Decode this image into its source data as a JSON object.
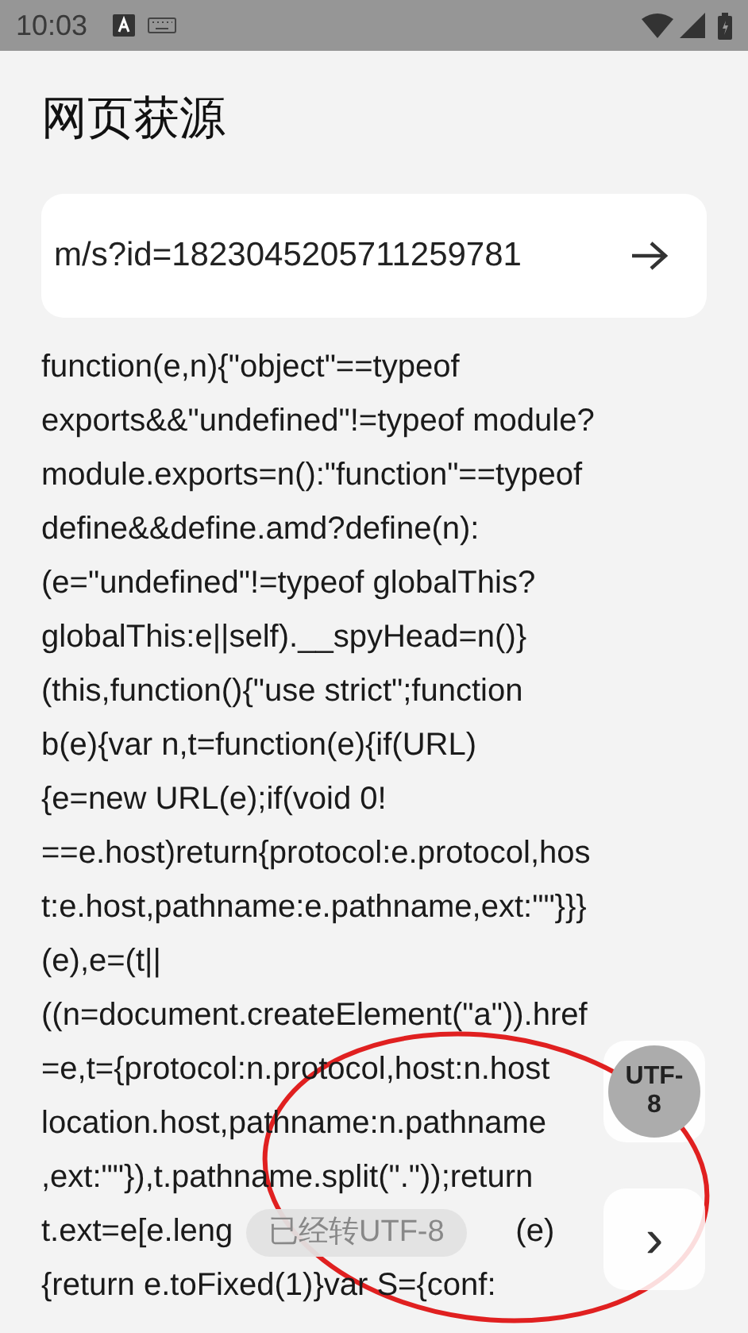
{
  "status_bar": {
    "time": "10:03"
  },
  "title": "网页获源",
  "url_field": {
    "value": "m/s?id=1823045205711259781"
  },
  "code_lines": [
    [
      "function(e,n){\"object\"==typeof"
    ],
    [
      "exports&&\"undefined\"!=typeof module?"
    ],
    [
      "module.exports=n():\"function\"==typeof"
    ],
    [
      "define&&define.amd?define(n):"
    ],
    [
      "(e=\"undefined\"!=typeof globalThis?"
    ],
    [
      "globalThis:e||self).__spyHead=n()}"
    ],
    [
      "(this,function(){\"use strict\";function"
    ],
    [
      "b(e){var n,t=function(e){if(URL)"
    ],
    [
      "{e=new URL(e);if(void 0!"
    ],
    [
      "==e.host)return{protocol:e.protocol,hos"
    ],
    [
      "t:e.host,pathname:e.pathname,ext:\"\"}}}"
    ],
    [
      "(e),e=(t||"
    ],
    [
      "((n=document.createElement(\"a\")).href"
    ],
    [
      "=e,t={protocol:n.protocol,host:n.host"
    ],
    [
      "location.host,pathname:n.pathname"
    ],
    [
      ",ext:\"\"}),t.pathname.split(\".\"));return"
    ],
    [
      "t.ext=e[e.leng",
      "(e)"
    ],
    [
      "{return e.toFixed(1)}var S={conf:"
    ]
  ],
  "encoding_button": {
    "label": "UTF-8"
  },
  "next_button": {
    "label": "›"
  },
  "toast": {
    "text": "已经转UTF-8"
  }
}
